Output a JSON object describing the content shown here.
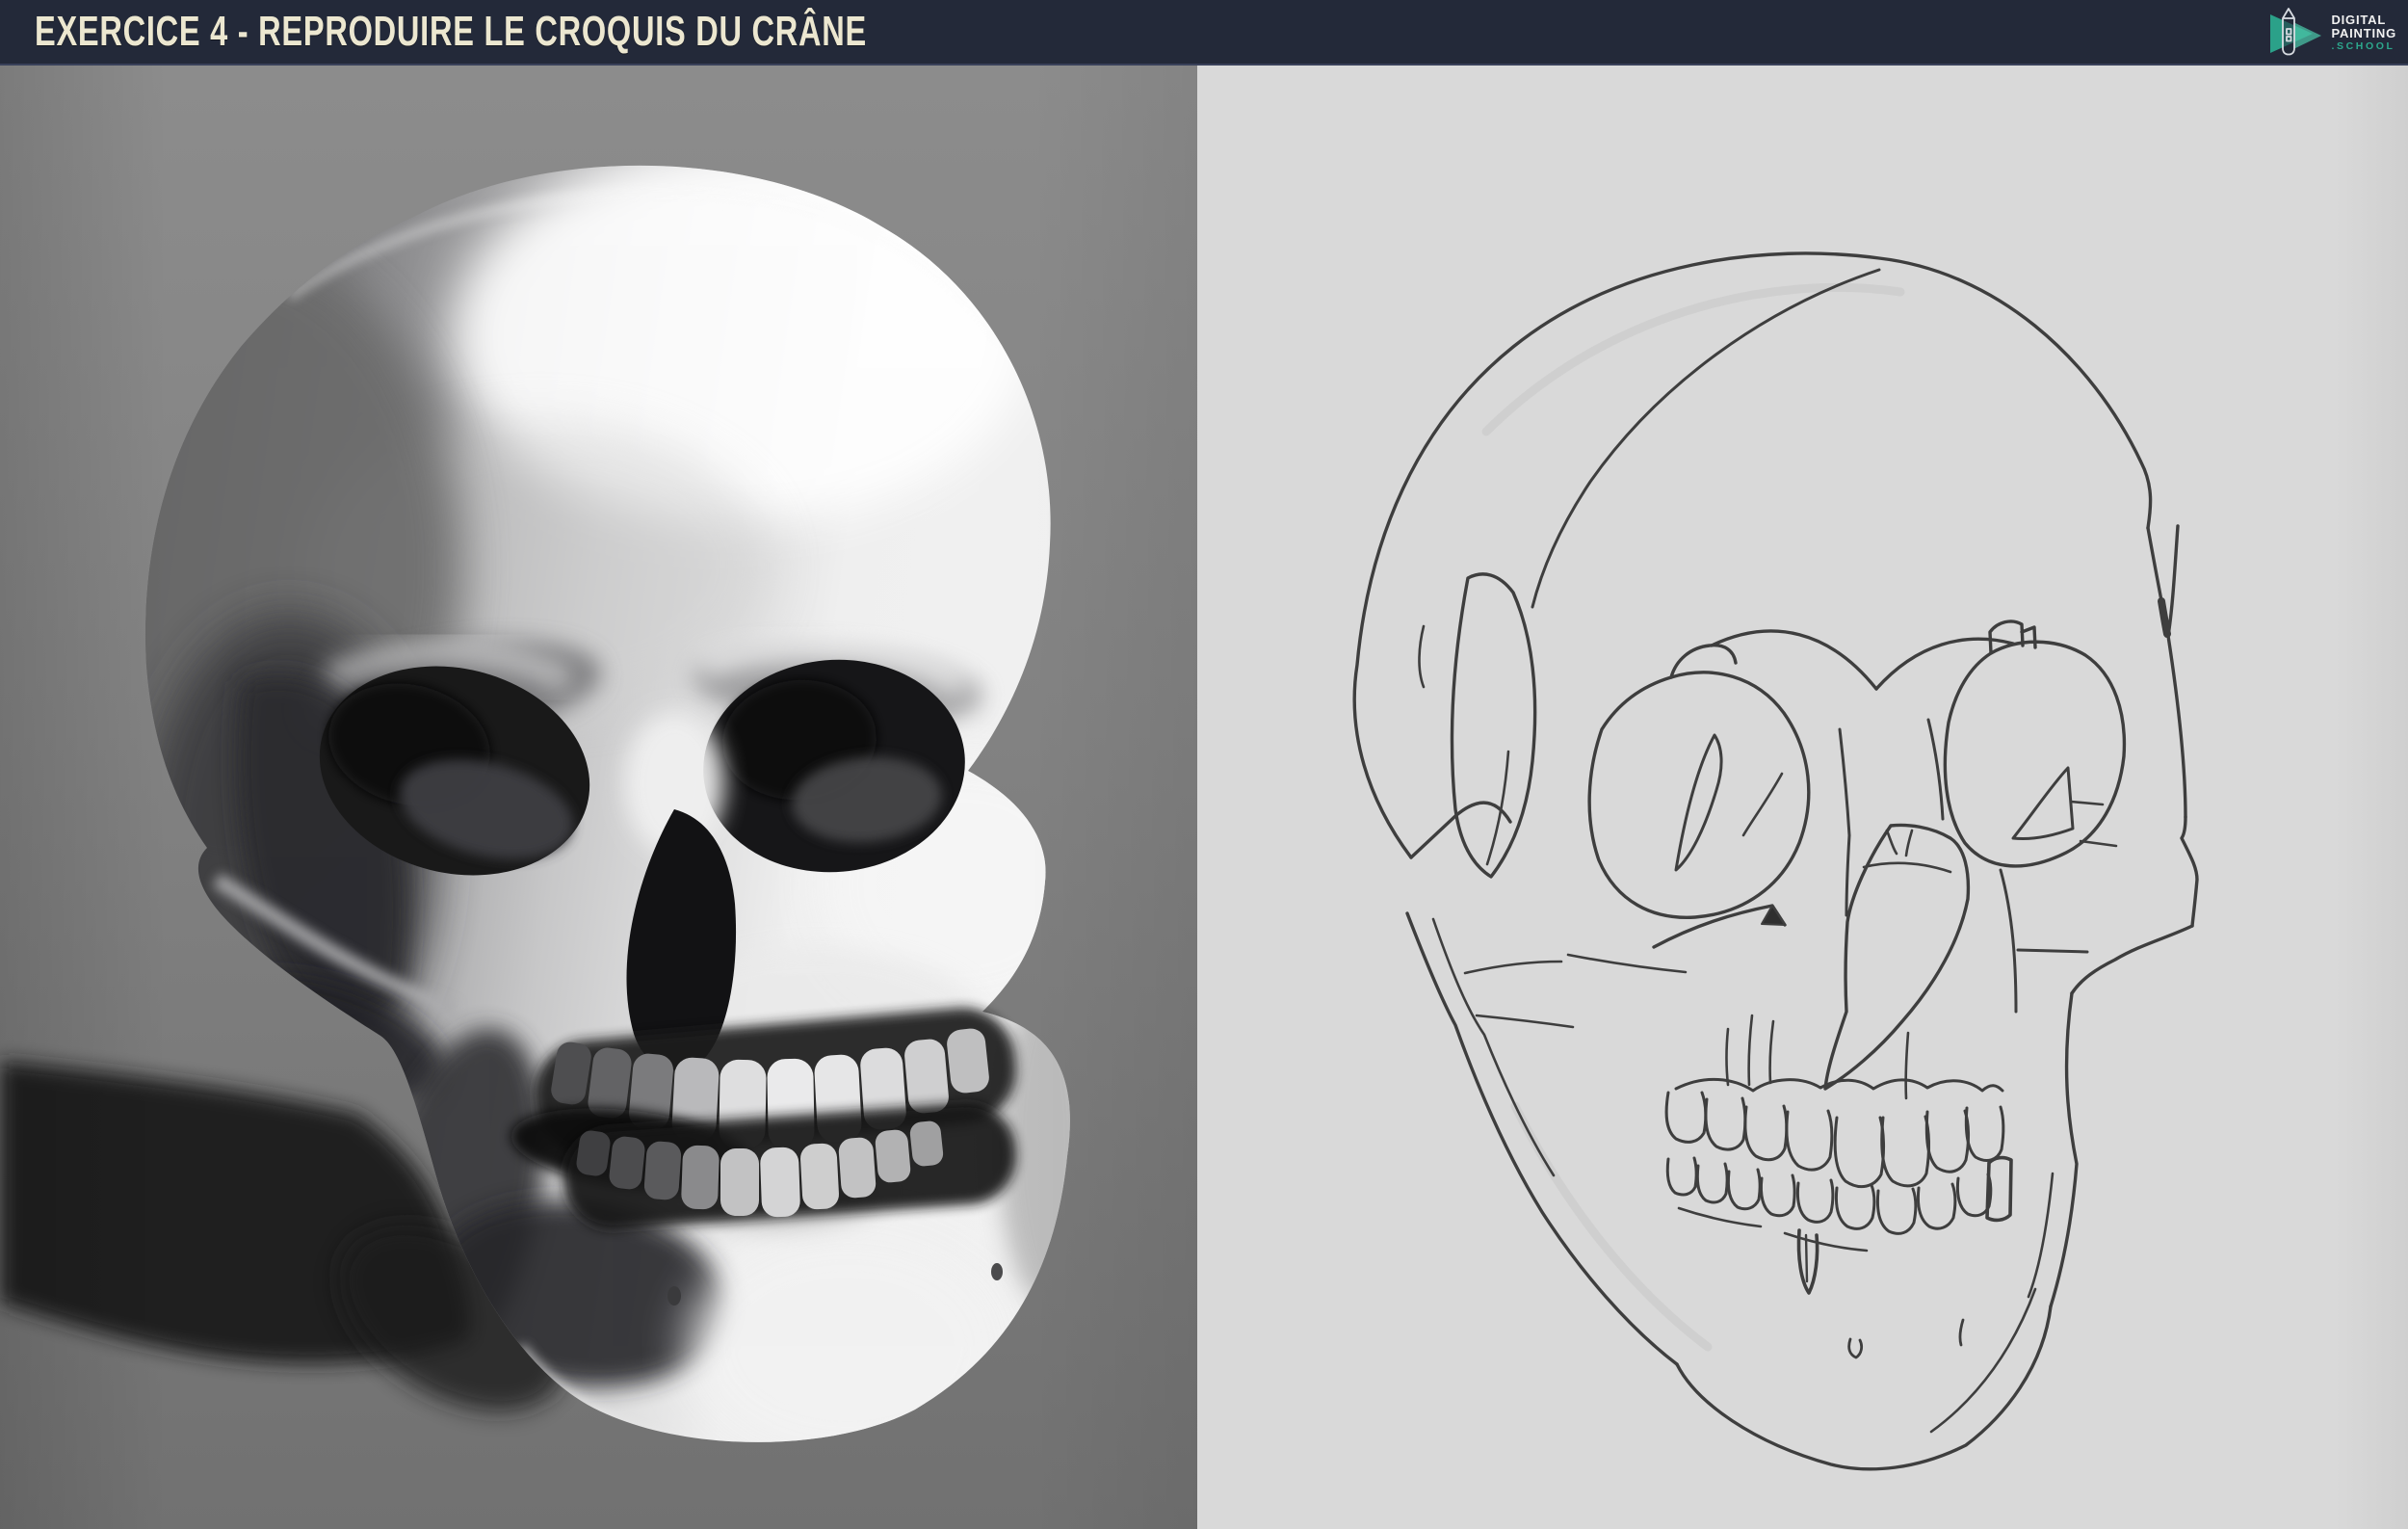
{
  "header": {
    "title": "EXERCICE 4 - REPRODUIRE LE CROQUIS DU CRÂNE",
    "colors": {
      "background": "#232939",
      "title_text": "#ece7d0"
    },
    "logo": {
      "icon": "stylus-play-icon",
      "line1": "DIGITAL",
      "line2": "PAINTING",
      "line3": ".SCHOOL",
      "colors": {
        "accent": "#2ca88d",
        "text": "#f1f1f1"
      }
    }
  },
  "content": {
    "left_panel": {
      "name": "skull-3d-reference",
      "background": "#7e7e7e"
    },
    "right_panel": {
      "name": "skull-croquis-sketch",
      "background": "#d9d9d9",
      "line_color": "#3e3e3e"
    }
  }
}
